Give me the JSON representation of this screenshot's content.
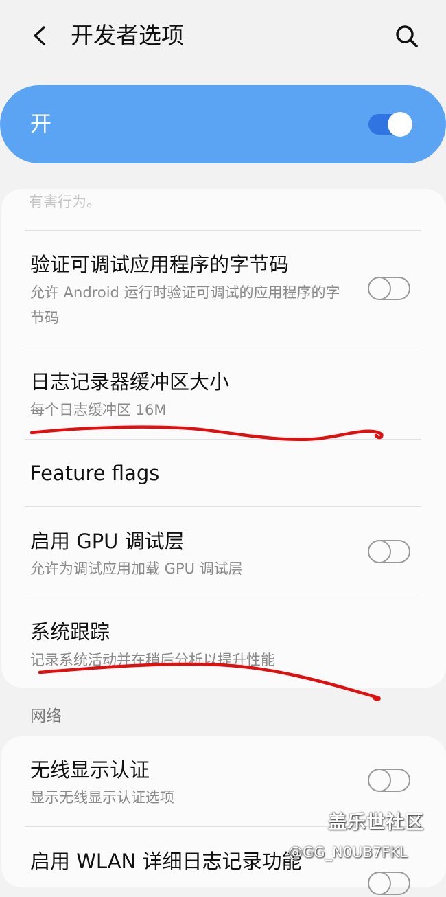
{
  "header": {
    "title": "开发者选项",
    "back_icon": "chevron-left-icon",
    "search_icon": "search-icon"
  },
  "master_switch": {
    "label": "开",
    "state": "on",
    "color": "#5ba4f4"
  },
  "card_1": {
    "truncated_text": "有害行为。",
    "rows": [
      {
        "title": "验证可调试应用程序的字节码",
        "subtitle": "允许 Android 运行时验证可调试的应用程序的字节码",
        "toggle": "off"
      },
      {
        "title": "日志记录器缓冲区大小",
        "subtitle": "每个日志缓冲区 16M"
      },
      {
        "title": "Feature flags"
      },
      {
        "title": "启用 GPU 调试层",
        "subtitle": "允许为调试应用加载 GPU 调试层",
        "toggle": "off"
      },
      {
        "title": "系统跟踪",
        "subtitle": "记录系统活动并在稍后分析以提升性能"
      }
    ]
  },
  "network_section": {
    "header": "网络",
    "rows": [
      {
        "title": "无线显示认证",
        "subtitle": "显示无线显示认证选项",
        "toggle": "off"
      },
      {
        "title": "启用 WLAN 详细日志记录功能"
      }
    ]
  },
  "watermark": {
    "site": "盖乐世社区",
    "user": "@GG_N0UB7FKL"
  },
  "annotation_color": "#e01010"
}
